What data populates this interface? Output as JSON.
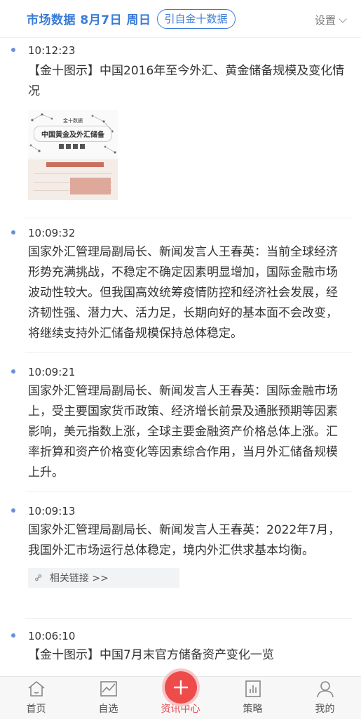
{
  "header": {
    "title": "市场数据 8月7日 周日",
    "source_pill": "引自金十数据",
    "settings_label": "设置"
  },
  "feed": [
    {
      "time": "10:12:23",
      "text": "【金十图示】中国2016年至今外汇、黄金储备规模及变化情况",
      "image": {
        "brand": "金十数据",
        "title": "中国黄金及外汇储备"
      }
    },
    {
      "time": "10:09:32",
      "text": "国家外汇管理局副局长、新闻发言人王春英：当前全球经济形势充满挑战，不稳定不确定因素明显增加，国际金融市场波动性较大。但我国高效统筹疫情防控和经济社会发展，经济韧性强、潜力大、活力足，长期向好的基本面不会改变，将继续支持外汇储备规模保持总体稳定。"
    },
    {
      "time": "10:09:21",
      "text": "国家外汇管理局副局长、新闻发言人王春英：国际金融市场上，受主要国家货币政策、经济增长前景及通胀预期等因素影响，美元指数上涨，全球主要金融资产价格总体上涨。汇率折算和资产价格变化等因素综合作用，当月外汇储备规模上升。"
    },
    {
      "time": "10:09:13",
      "text": "国家外汇管理局副局长、新闻发言人王春英：2022年7月，我国外汇市场运行总体稳定，境内外汇供求基本均衡。",
      "link_label": "相关链接 >>"
    },
    {
      "time": "10:06:10",
      "text": "【金十图示】中国7月末官方储备资产变化一览"
    }
  ],
  "tabbar": {
    "items": [
      {
        "label": "首页",
        "icon": "home-icon"
      },
      {
        "label": "自选",
        "icon": "watchlist-chart-icon"
      },
      {
        "label": "资讯中心",
        "icon": "plus-icon"
      },
      {
        "label": "策略",
        "icon": "strategy-bar-icon"
      },
      {
        "label": "我的",
        "icon": "user-icon"
      }
    ],
    "active": "资讯中心"
  },
  "colors": {
    "accent": "#3a7bd5",
    "active_tab": "#e5484d",
    "center_button": "#ee4b4b"
  }
}
